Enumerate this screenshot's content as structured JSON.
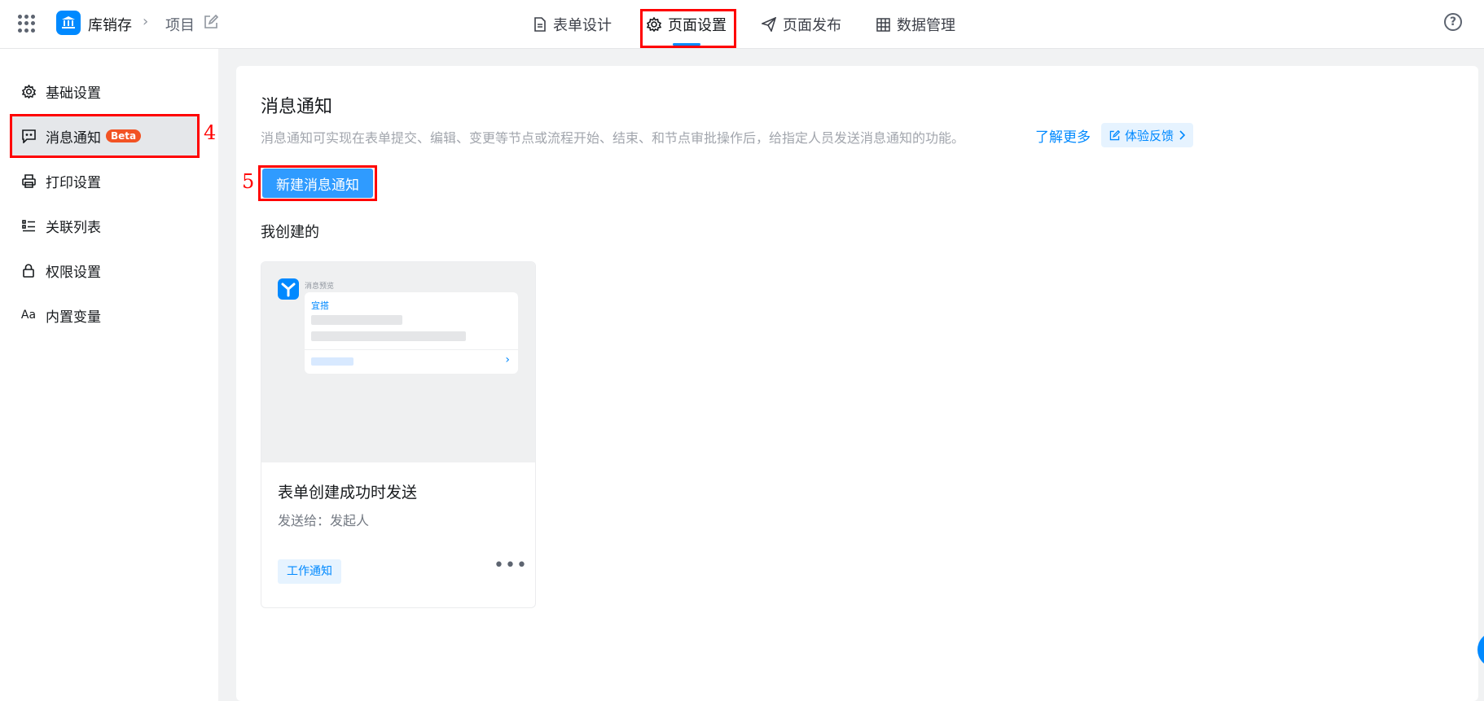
{
  "header": {
    "app_name": "库销存",
    "crumb_separator": "›",
    "project": "项目",
    "tabs": [
      {
        "label": "表单设计",
        "icon": "document-icon"
      },
      {
        "label": "页面设置",
        "icon": "gear-icon",
        "active": true
      },
      {
        "label": "页面发布",
        "icon": "send-icon"
      },
      {
        "label": "数据管理",
        "icon": "table-icon"
      }
    ],
    "help": "?"
  },
  "sidebar": {
    "items": [
      {
        "label": "基础设置",
        "icon": "gear-icon"
      },
      {
        "label": "消息通知",
        "icon": "message-icon",
        "badge": "Beta",
        "active": true
      },
      {
        "label": "打印设置",
        "icon": "printer-icon"
      },
      {
        "label": "关联列表",
        "icon": "list-icon"
      },
      {
        "label": "权限设置",
        "icon": "lock-icon"
      },
      {
        "label": "内置变量",
        "icon": "font-icon",
        "icon_text": "Aa"
      }
    ]
  },
  "annotations": {
    "sidebar_marker": "4",
    "button_marker": "5",
    "highlight_color": "#ff0000"
  },
  "main": {
    "title": "消息通知",
    "description": "消息通知可实现在表单提交、编辑、变更等节点或流程开始、结束、和节点审批操作后，给指定人员发送消息通知的功能。",
    "learn_more": "了解更多",
    "feedback": "体验反馈",
    "new_button": "新建消息通知",
    "section_title": "我创建的",
    "cards": [
      {
        "preview_tag": "消息预览",
        "preview_label": "宜搭",
        "title": "表单创建成功时发送",
        "subtitle": "发送给：发起人",
        "tag": "工作通知",
        "more": "•••"
      }
    ]
  },
  "colors": {
    "accent": "#0089ff",
    "button": "#2f9bff",
    "beta": "#f25324"
  }
}
